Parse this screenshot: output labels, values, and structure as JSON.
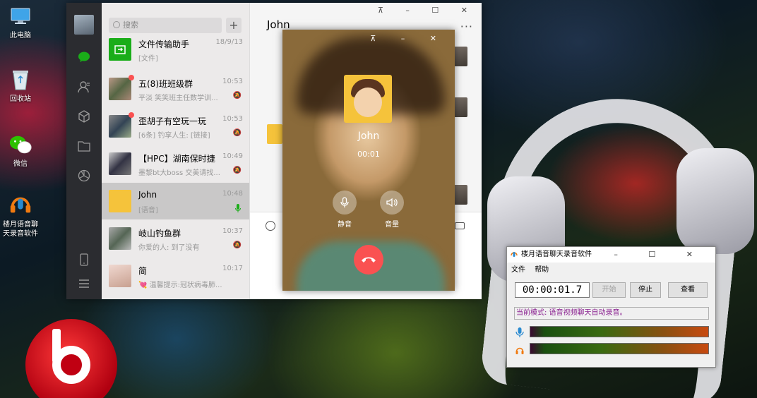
{
  "desktop": {
    "icons": [
      {
        "label": "此电脑"
      },
      {
        "label": "回收站"
      },
      {
        "label": "微信"
      },
      {
        "label": "楼月语音聊天录音软件"
      }
    ]
  },
  "wechat": {
    "search_placeholder": "搜索",
    "plus_label": "+",
    "window_buttons": "⊼ – ☐ ✕",
    "chat_title": "John",
    "more_label": "···",
    "chats": [
      {
        "name": "文件传输助手",
        "time": "18/9/13",
        "msg": "[文件]",
        "unread": false,
        "muted": false
      },
      {
        "name": "五(8)班班级群",
        "time": "10:53",
        "msg": "平淡  笑笑班主任数学训...",
        "unread": true,
        "muted": true
      },
      {
        "name": "歪胡子有空玩一玩",
        "time": "10:53",
        "msg": "[6条] 钓享人生: [链接]",
        "unread": true,
        "muted": true
      },
      {
        "name": "【HPC】湖南保时捷...",
        "time": "10:49",
        "msg": "墨黎bt大boss 交美请找...",
        "unread": false,
        "muted": true
      },
      {
        "name": "John",
        "time": "10:48",
        "msg": "[语音]",
        "unread": false,
        "muted": false,
        "active": true
      },
      {
        "name": "岐山钓鱼群",
        "time": "10:37",
        "msg": "你爱的人: 到了没有",
        "unread": false,
        "muted": true
      },
      {
        "name": "简",
        "time": "10:17",
        "msg": "💘 温馨提示:冠状病毒肺...",
        "unread": false,
        "muted": false
      }
    ]
  },
  "call": {
    "window_buttons": "⊼ – ✕",
    "name": "John",
    "duration": "00:01",
    "mute_label": "静音",
    "volume_label": "音量"
  },
  "recorder": {
    "title": "楼月语音聊天录音软件",
    "window_buttons": "– ☐ ✕",
    "menu": {
      "file": "文件",
      "help": "帮助"
    },
    "timer": "00:00:01.7",
    "start_label": "开始",
    "stop_label": "停止",
    "view_label": "查看",
    "status": "当前模式: 语音视频聊天自动录音。",
    "mic_level": 0.95,
    "speaker_level": 0.95
  },
  "colors": {
    "wechat_green": "#1aad19",
    "hangup_red": "#fa5151",
    "status_purple": "#8a2090"
  }
}
